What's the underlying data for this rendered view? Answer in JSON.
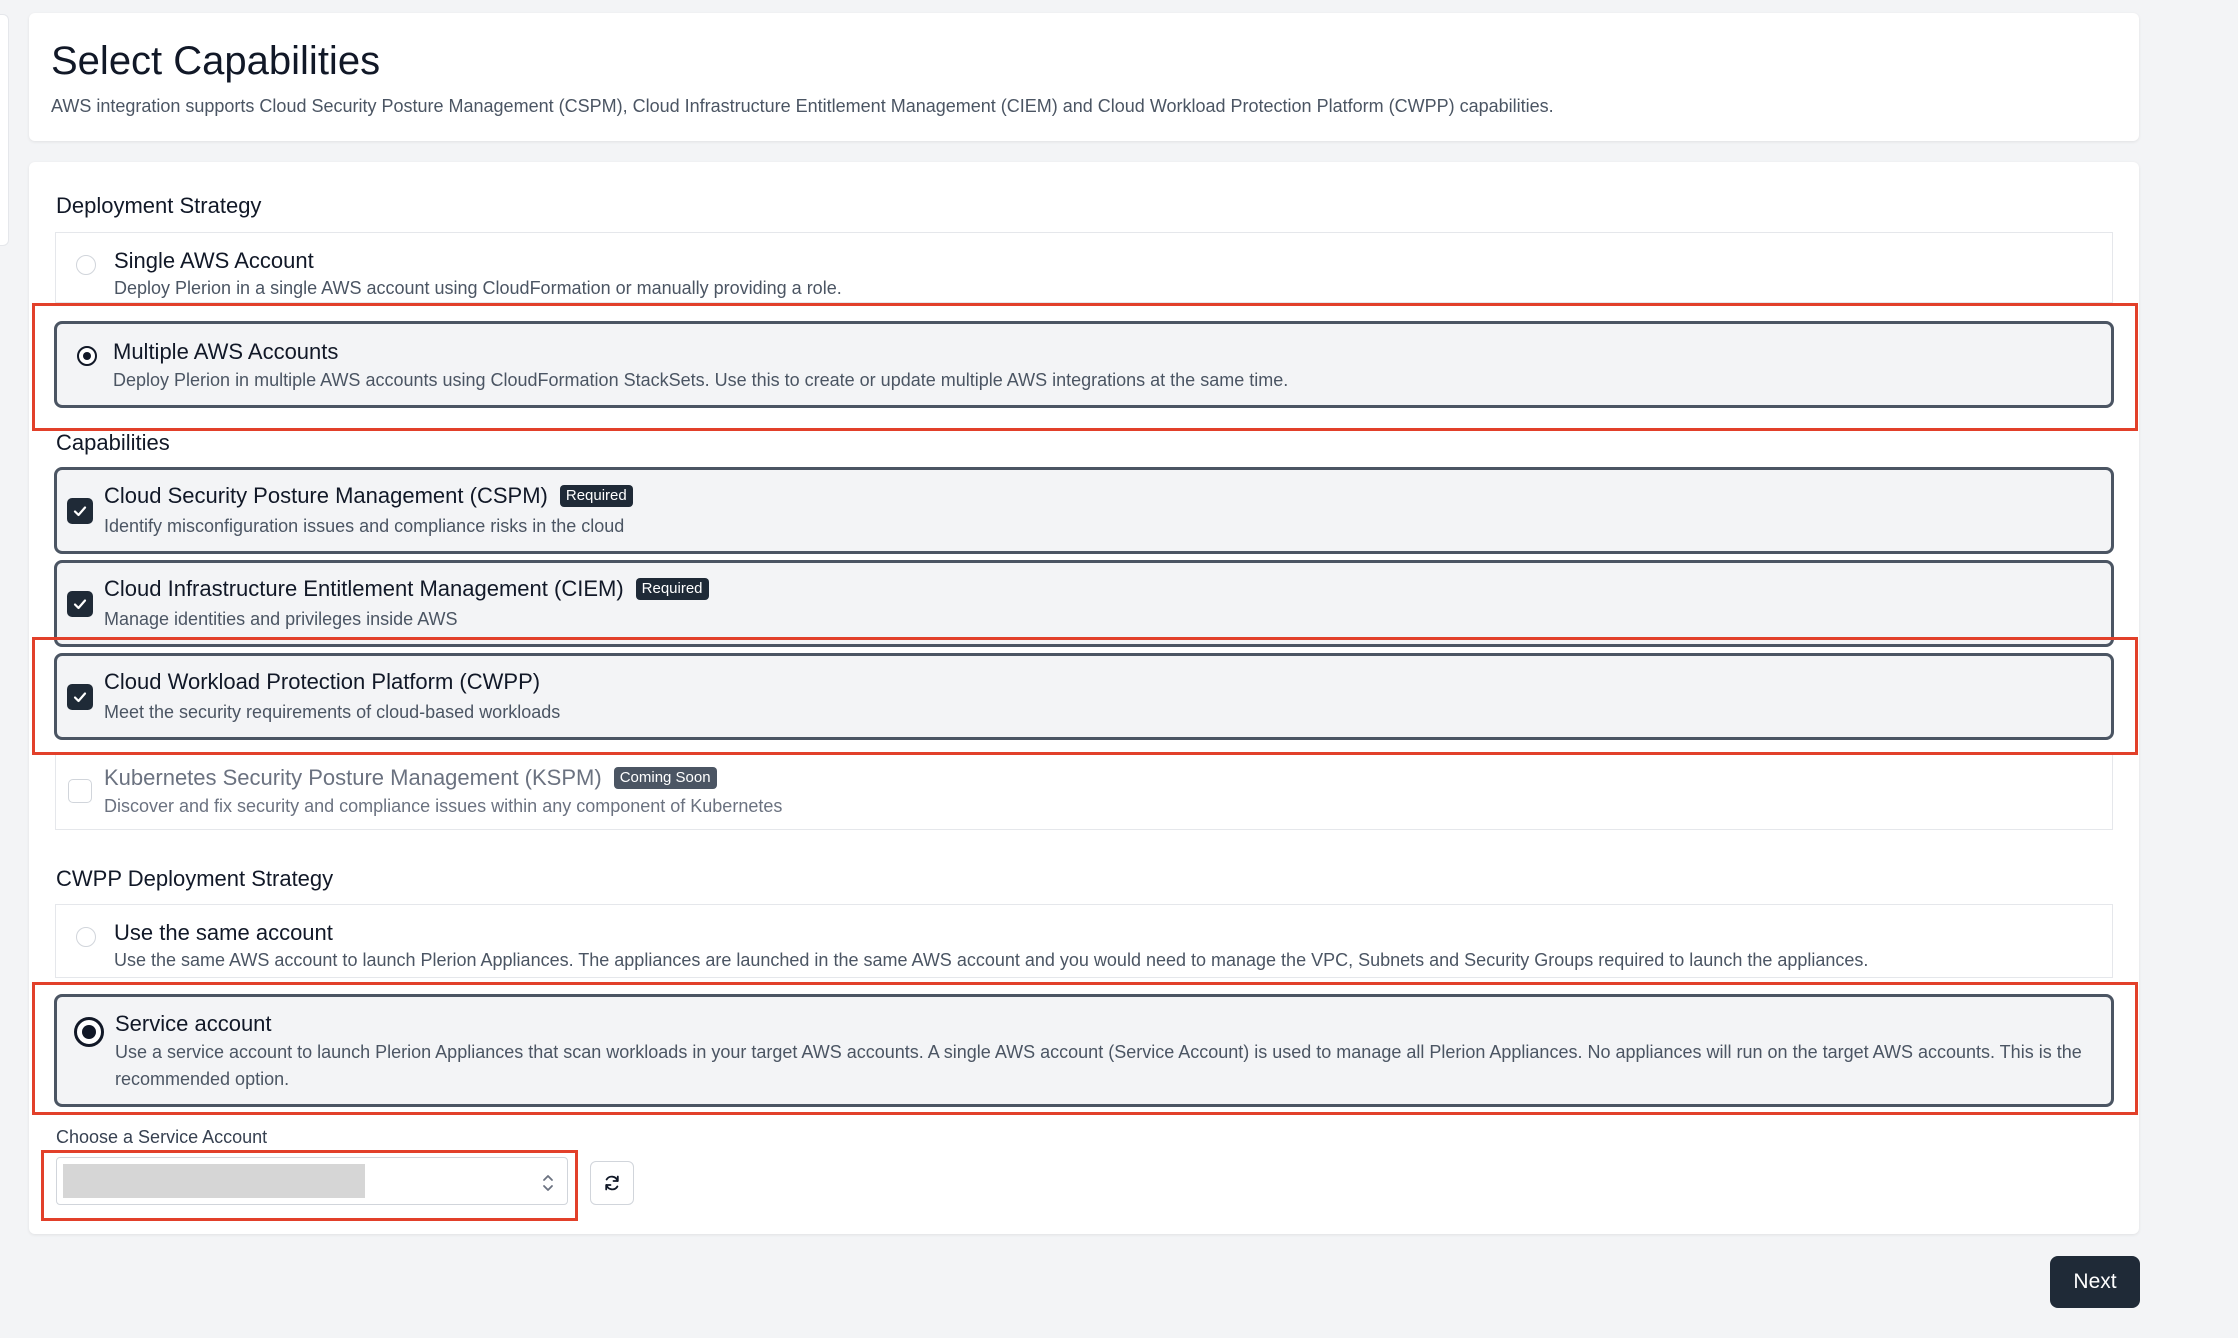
{
  "header": {
    "title": "Select Capabilities",
    "subtitle": "AWS integration supports Cloud Security Posture Management (CSPM), Cloud Infrastructure Entitlement Management (CIEM) and Cloud Workload Protection Platform (CWPP) capabilities."
  },
  "deployment_strategy": {
    "heading": "Deployment Strategy",
    "options": [
      {
        "title": "Single AWS Account",
        "description": "Deploy Plerion in a single AWS account using CloudFormation or manually providing a role.",
        "selected": false
      },
      {
        "title": "Multiple AWS Accounts",
        "description": "Deploy Plerion in multiple AWS accounts using CloudFormation StackSets. Use this to create or update multiple AWS integrations at the same time.",
        "selected": true
      }
    ]
  },
  "capabilities": {
    "heading": "Capabilities",
    "items": [
      {
        "title": "Cloud Security Posture Management (CSPM)",
        "badge": "Required",
        "description": "Identify misconfiguration issues and compliance risks in the cloud",
        "checked": true
      },
      {
        "title": "Cloud Infrastructure Entitlement Management (CIEM)",
        "badge": "Required",
        "description": "Manage identities and privileges inside AWS",
        "checked": true
      },
      {
        "title": "Cloud Workload Protection Platform (CWPP)",
        "badge": "",
        "description": "Meet the security requirements of cloud-based workloads",
        "checked": true
      },
      {
        "title": "Kubernetes Security Posture Management (KSPM)",
        "badge": "Coming Soon",
        "description": "Discover and fix security and compliance issues within any component of Kubernetes",
        "checked": false
      }
    ]
  },
  "cwpp_strategy": {
    "heading": "CWPP Deployment Strategy",
    "options": [
      {
        "title": "Use the same account",
        "description": "Use the same AWS account to launch Plerion Appliances. The appliances are launched in the same AWS account and you would need to manage the VPC, Subnets and Security Groups required to launch the appliances.",
        "selected": false
      },
      {
        "title": "Service account",
        "description": "Use a service account to launch Plerion Appliances that scan workloads in your target AWS accounts. A single AWS account (Service Account) is used to manage all Plerion Appliances. No appliances will run on the target AWS accounts. This is the recommended option.",
        "selected": true
      }
    ]
  },
  "service_account": {
    "label": "Choose a Service Account"
  },
  "footer": {
    "next_label": "Next"
  },
  "colors": {
    "highlight": "#e2402a",
    "primary_dark": "#1f2a37",
    "page_bg": "#f3f4f6"
  },
  "icons": [
    "check-icon",
    "chevron-updown-icon",
    "refresh-icon"
  ]
}
